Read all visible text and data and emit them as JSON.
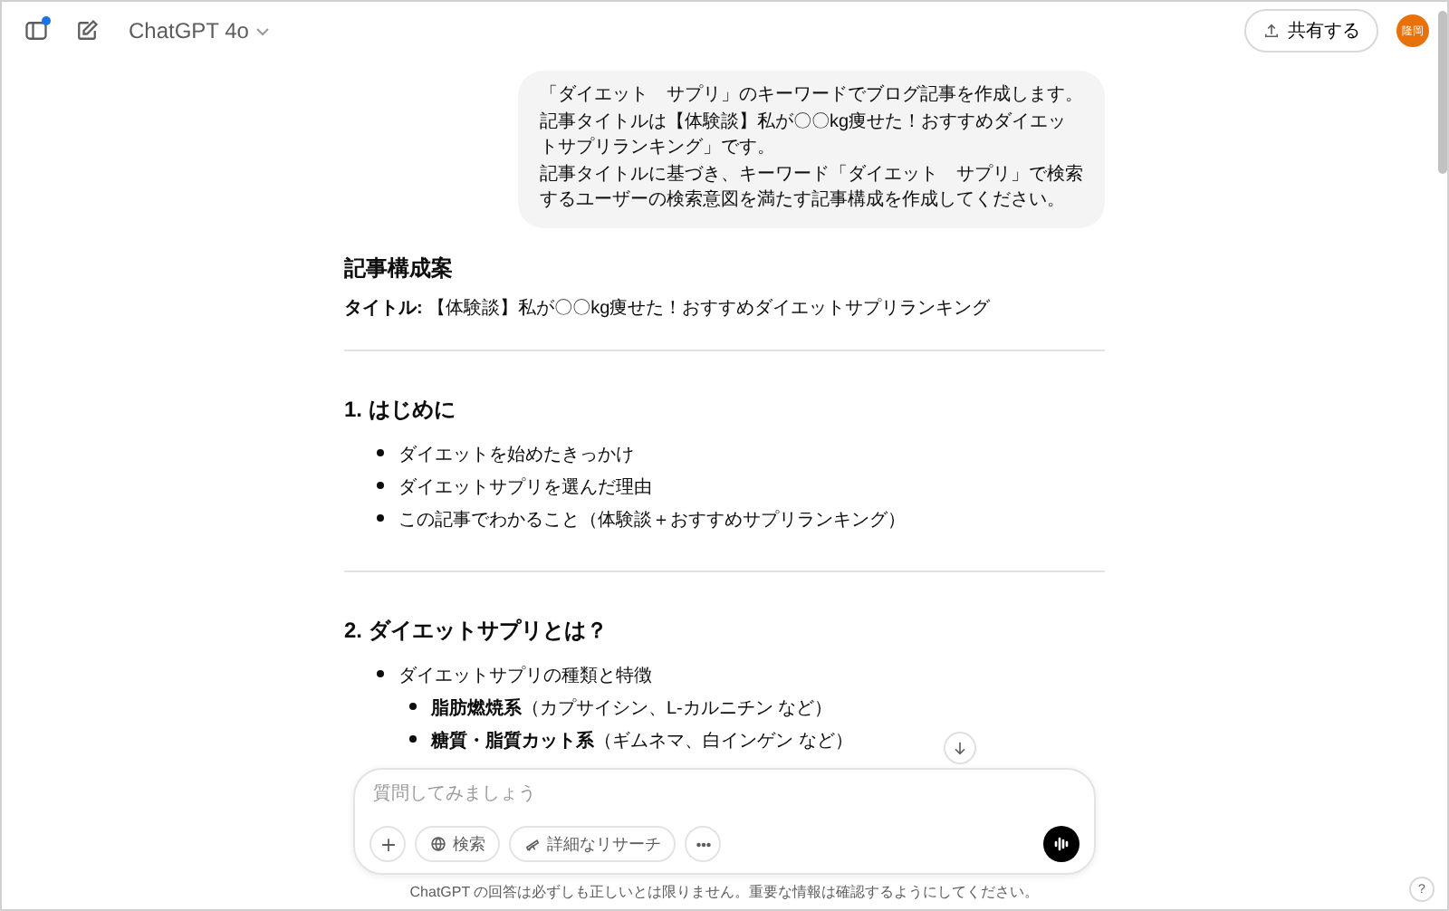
{
  "header": {
    "model": "ChatGPT 4o",
    "share_button": "共有する",
    "avatar": "隆岡",
    "sidebar_badge": true
  },
  "user_message": {
    "lines": [
      "「ダイエット　サプリ」のキーワードでブログ記事を作成します。",
      "記事タイトルは【体験談】私が〇〇kg痩せた！おすすめダイエットサプリランキング」です。",
      "記事タイトルに基づき、キーワード「ダイエット　サプリ」で検索するユーザーの検索意図を満たす記事構成を作成してください。"
    ]
  },
  "response": {
    "heading": "記事構成案",
    "title_line": "**タイトル:** 【体験談】私が〇〇kg痩せた！おすすめダイエットサプリランキング",
    "sections": [
      {
        "heading": "1. はじめに",
        "items": [
          {
            "text": "ダイエットを始めたきっかけ"
          },
          {
            "text": "ダイエットサプリを選んだ理由"
          },
          {
            "text": "この記事でわかること（体験談＋おすすめサプリランキング）"
          }
        ]
      },
      {
        "heading": "2. ダイエットサプリとは？",
        "items": [
          {
            "text": "ダイエットサプリの種類と特徴",
            "children": [
              {
                "text": "**脂肪燃焼系**（カプサイシン、L-カルニチン など）"
              },
              {
                "text": "**糖質・脂質カット系**（ギムネマ、白インゲン など）"
              }
            ]
          }
        ]
      }
    ]
  },
  "composer": {
    "placeholder": "質問してみましょう",
    "tools": [
      "検索",
      "詳細なリサーチ"
    ]
  },
  "disclaimer": "ChatGPT の回答は必ずしも正しいとは限りません。重要な情報は確認するようにしてください。",
  "help_button": "?"
}
